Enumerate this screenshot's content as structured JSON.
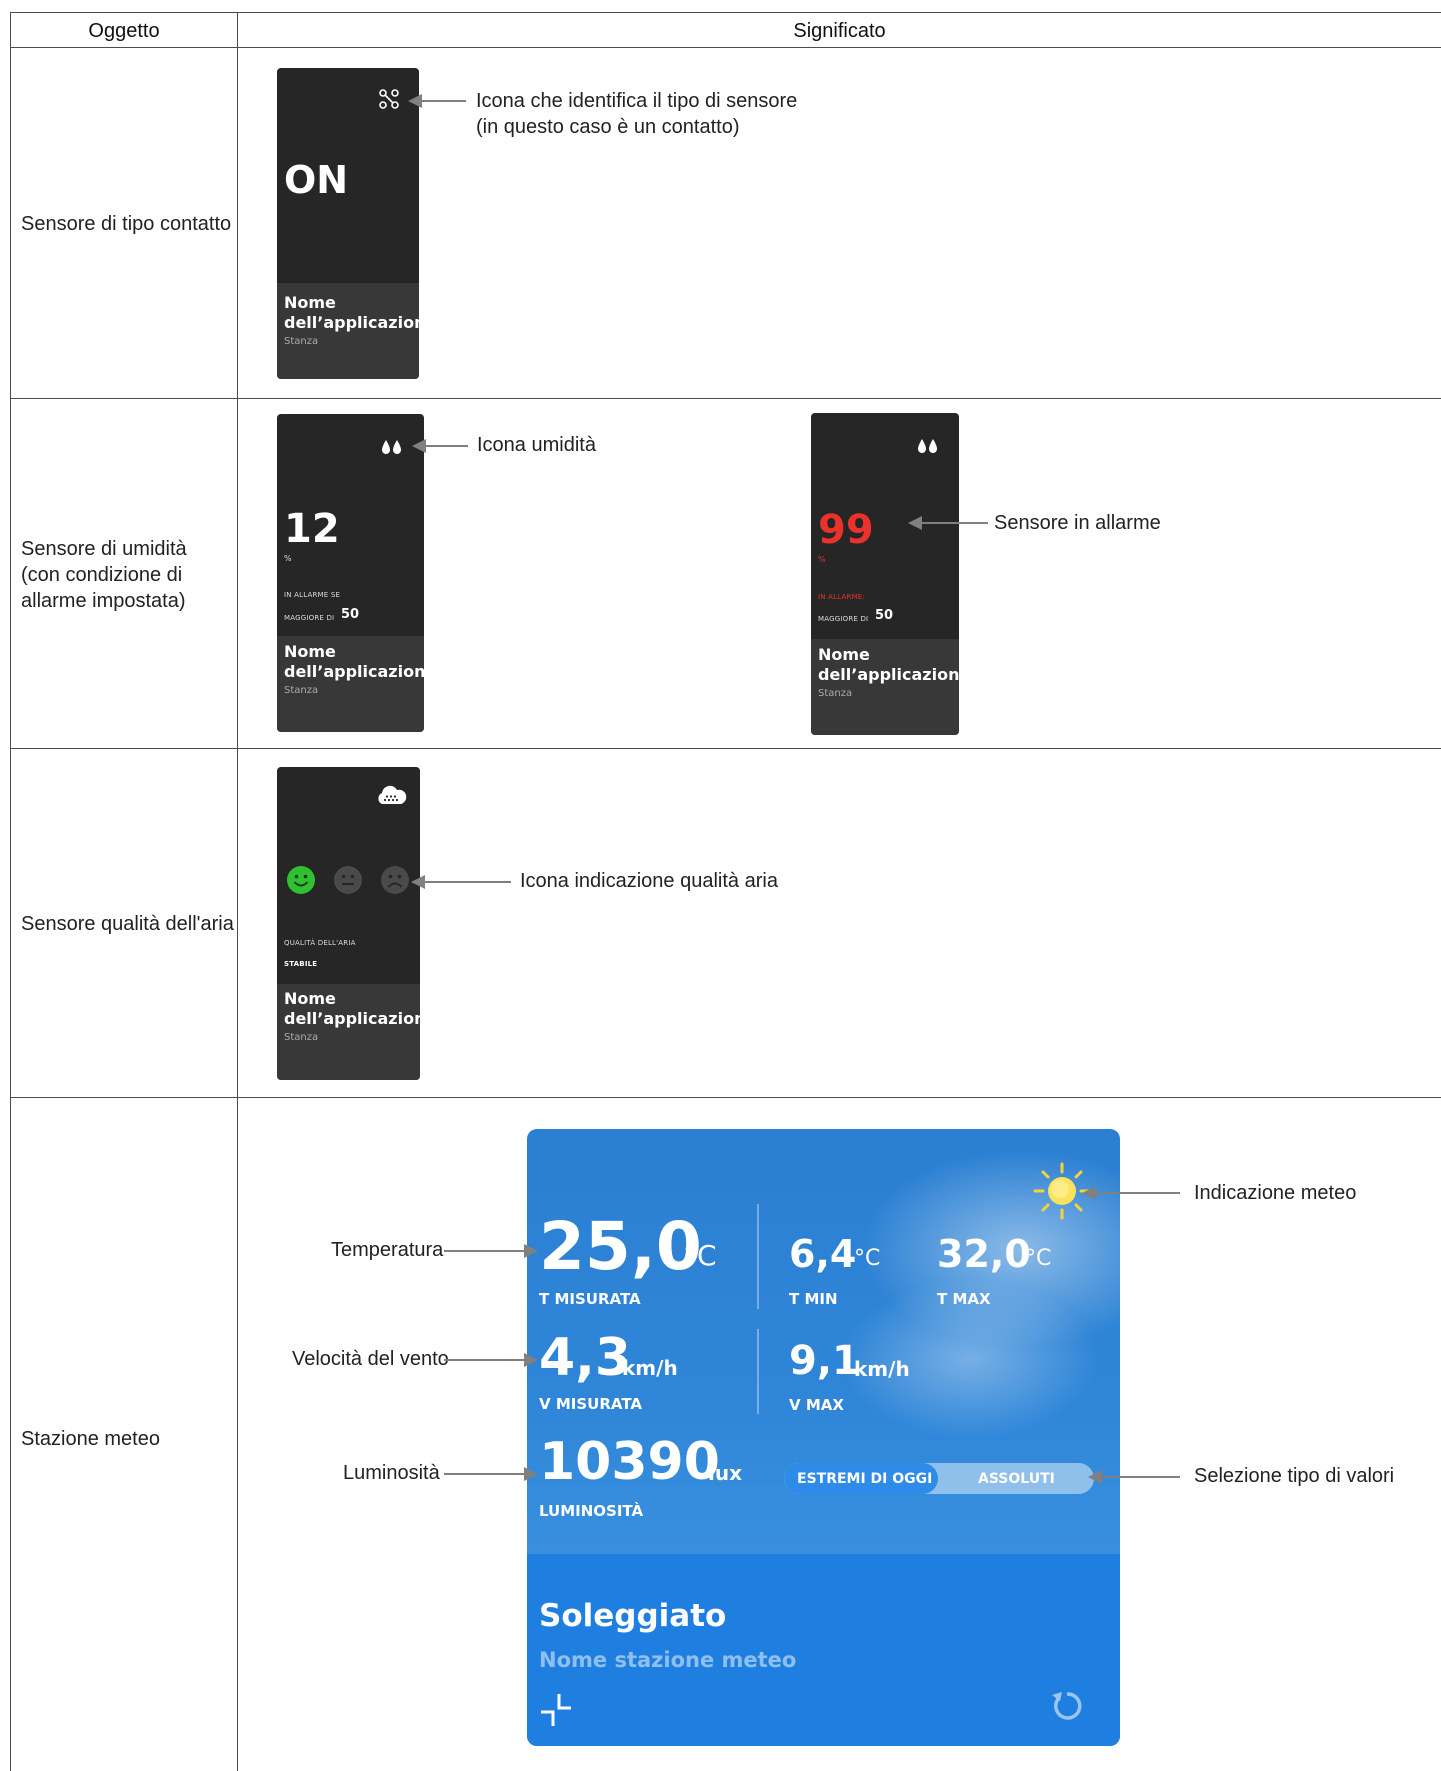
{
  "table": {
    "header_col1": "Oggetto",
    "header_col2": "Significato",
    "rows": [
      {
        "label": "Sensore di tipo contatto"
      },
      {
        "label": "Sensore di umidità\n(con condizione di\nallarme impostata)"
      },
      {
        "label": "Sensore qualità dell'aria"
      },
      {
        "label": "Stazione meteo"
      }
    ]
  },
  "contact_card": {
    "icon": "contact-sensor-icon",
    "state": "ON",
    "name": "Nome\ndell’applicazione",
    "room": "Stanza",
    "annotation": "Icona che identifica il tipo di sensore\n(in questo caso è un contatto)"
  },
  "humidity_card": {
    "icon": "humidity-drops-icon",
    "value": "12",
    "unit": "%",
    "alarm_line1": "IN ALLARME SE",
    "alarm_line2_prefix": "MAGGIORE DI",
    "alarm_threshold": "50",
    "name": "Nome\ndell’applicazione",
    "room": "Stanza",
    "annotation": "Icona umidità"
  },
  "humidity_alarm_card": {
    "icon": "humidity-drops-icon",
    "value": "99",
    "unit": "%",
    "alarm_line1": "IN ALLARME:",
    "alarm_line2_prefix": "MAGGIORE DI",
    "alarm_threshold": "50",
    "name": "Nome\ndell’applicazione",
    "room": "Stanza",
    "annotation": "Sensore in allarme",
    "alarm_color": "#e8322b"
  },
  "air_card": {
    "icon": "air-quality-cloud-icon",
    "faces": [
      "happy-face-icon",
      "neutral-face-icon",
      "sad-face-icon"
    ],
    "active_face_color": "#2fc12f",
    "label": "QUALITÀ DELL'ARIA",
    "status": "STABILE",
    "name": "Nome\ndell’applicazione",
    "room": "Stanza",
    "annotation": "Icona indicazione qualità aria"
  },
  "meteo": {
    "weather_icon": "sun-icon",
    "temp_value": "25,0",
    "temp_unit": "°C",
    "temp_label": "T MISURATA",
    "tmin_value": "6,4",
    "tmin_unit": "°C",
    "tmin_label": "T MIN",
    "tmax_value": "32,0",
    "tmax_unit": "°C",
    "tmax_label": "T MAX",
    "wind_value": "4,3",
    "wind_unit": "km/h",
    "wind_label": "V MISURATA",
    "vmax_value": "9,1",
    "vmax_unit": "km/h",
    "vmax_label": "V MAX",
    "lux_value": "10390",
    "lux_unit": "lux",
    "lux_label": "LUMINOSITÀ",
    "toggle_left": "ESTREMI DI OGGI",
    "toggle_right": "ASSOLUTI",
    "condition": "Soleggiato",
    "station_name": "Nome stazione meteo",
    "accent": "#1f7fe0"
  },
  "annotations": {
    "temperature": "Temperatura",
    "wind": "Velocità del vento",
    "luminosity": "Luminosità",
    "weather": "Indicazione meteo",
    "values_selection": "Selezione tipo di valori"
  }
}
